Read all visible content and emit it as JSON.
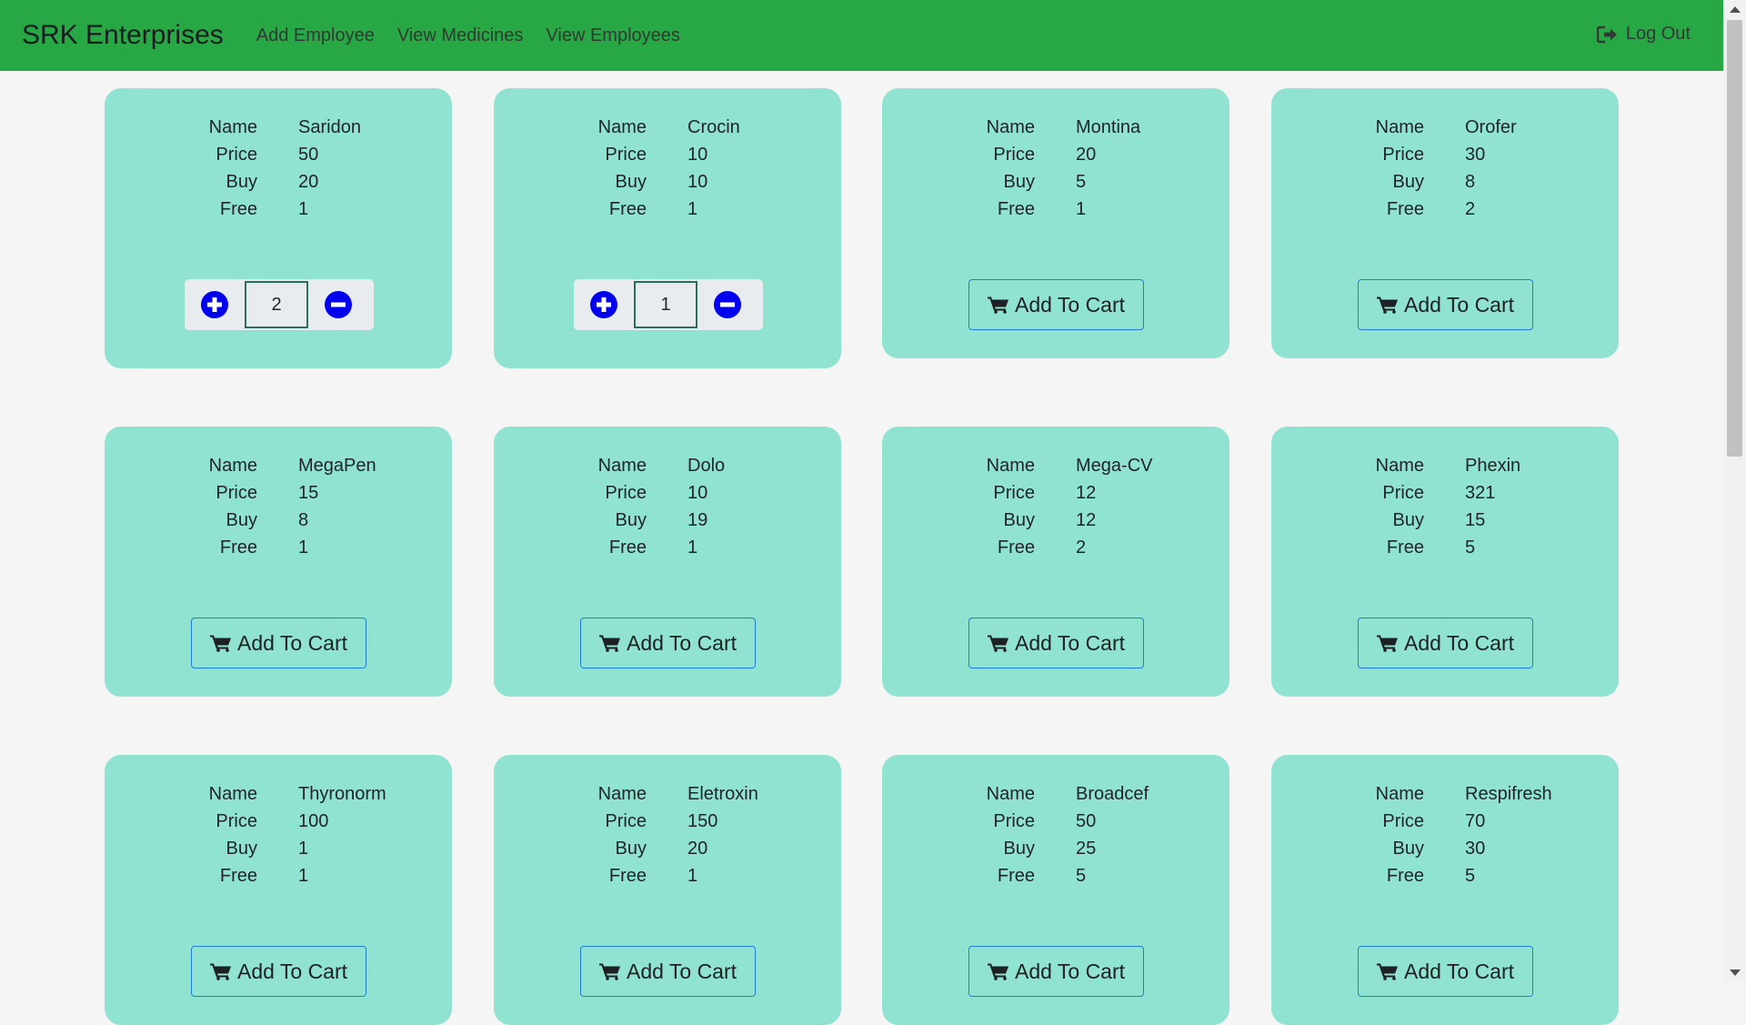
{
  "navbar": {
    "brand": "SRK Enterprises",
    "links": [
      "Add Employee",
      "View Medicines",
      "View Employees"
    ],
    "logout": "Log Out"
  },
  "labels": {
    "name": "Name",
    "price": "Price",
    "buy": "Buy",
    "free": "Free"
  },
  "add_to_cart": "Add To Cart",
  "colors": {
    "navbar": "#28a745",
    "card": "#90e3d1",
    "button_border": "#1f7fd6",
    "icon": "#0000ee"
  },
  "icons": {
    "cart": "shopping-cart-icon",
    "plus": "plus-circle-icon",
    "minus": "minus-circle-icon",
    "logout": "sign-out-icon"
  },
  "medicines": [
    {
      "name": "Saridon",
      "price": "50",
      "buy": "20",
      "free": "1",
      "qty": "2"
    },
    {
      "name": "Crocin",
      "price": "10",
      "buy": "10",
      "free": "1",
      "qty": "1"
    },
    {
      "name": "Montina",
      "price": "20",
      "buy": "5",
      "free": "1"
    },
    {
      "name": "Orofer",
      "price": "30",
      "buy": "8",
      "free": "2"
    },
    {
      "name": "MegaPen",
      "price": "15",
      "buy": "8",
      "free": "1"
    },
    {
      "name": "Dolo",
      "price": "10",
      "buy": "19",
      "free": "1"
    },
    {
      "name": "Mega-CV",
      "price": "12",
      "buy": "12",
      "free": "2"
    },
    {
      "name": "Phexin",
      "price": "321",
      "buy": "15",
      "free": "5"
    },
    {
      "name": "Thyronorm",
      "price": "100",
      "buy": "1",
      "free": "1"
    },
    {
      "name": "Eletroxin",
      "price": "150",
      "buy": "20",
      "free": "1"
    },
    {
      "name": "Broadcef",
      "price": "50",
      "buy": "25",
      "free": "5"
    },
    {
      "name": "Respifresh",
      "price": "70",
      "buy": "30",
      "free": "5"
    }
  ]
}
